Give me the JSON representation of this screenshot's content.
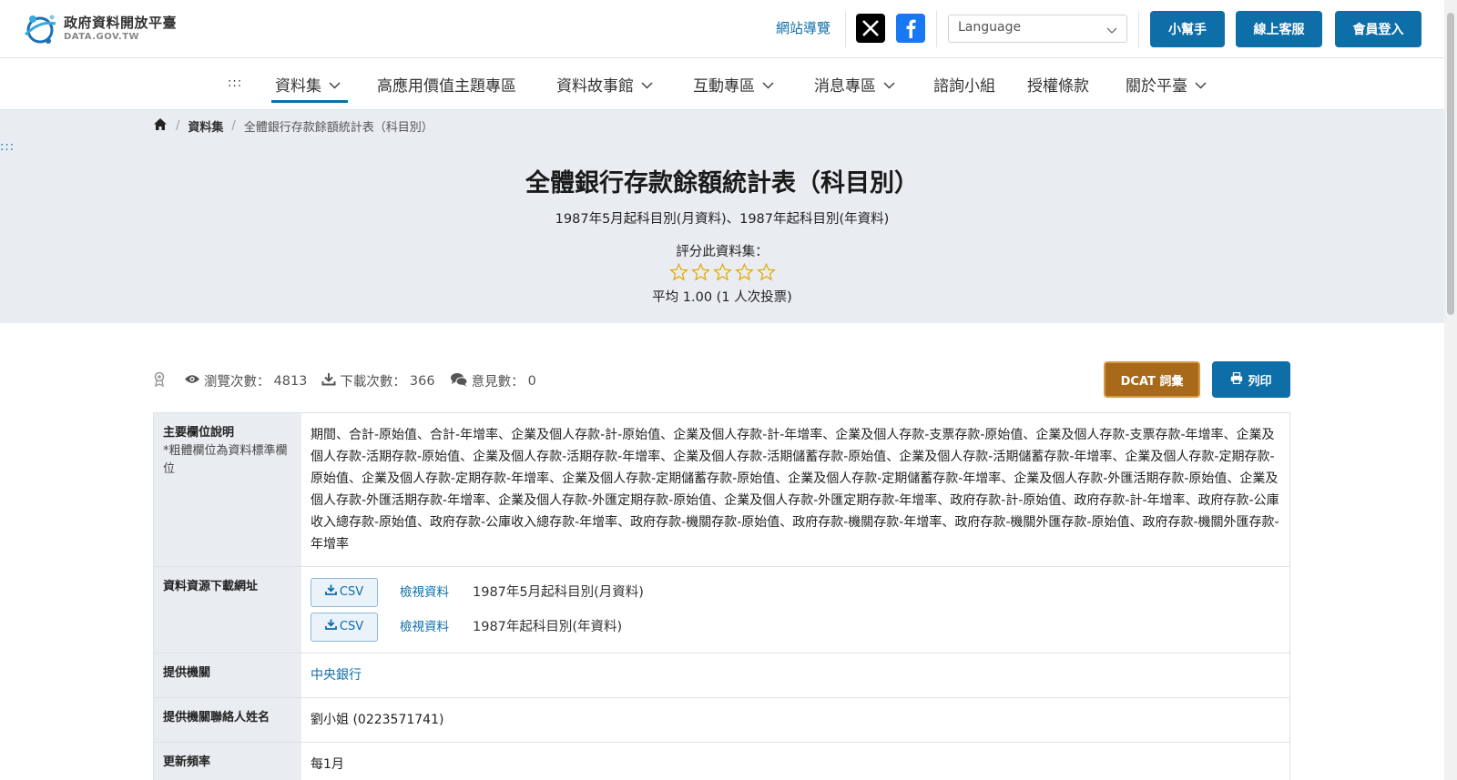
{
  "header": {
    "logo_title": "政府資料開放平臺",
    "logo_sub": "DATA.GOV.TW",
    "sitemap": "網站導覽",
    "language_placeholder": "Language",
    "buttons": {
      "helper": "小幫手",
      "service": "線上客服",
      "login": "會員登入"
    }
  },
  "nav": {
    "accesskey_top": ":::",
    "accesskey_side": ":::",
    "items": [
      {
        "label": "資料集",
        "dropdown": true,
        "active": true
      },
      {
        "label": "高應用價值主題專區",
        "dropdown": false
      },
      {
        "label": "資料故事館",
        "dropdown": true
      },
      {
        "label": "互動專區",
        "dropdown": true
      },
      {
        "label": "消息專區",
        "dropdown": true
      },
      {
        "label": "諮詢小組",
        "dropdown": false
      },
      {
        "label": "授權條款",
        "dropdown": false
      },
      {
        "label": "關於平臺",
        "dropdown": true
      }
    ]
  },
  "breadcrumb": {
    "level1": "資料集",
    "current": "全體銀行存款餘額統計表（科目別）"
  },
  "dataset": {
    "title": "全體銀行存款餘額統計表（科目別）",
    "subtitle": "1987年5月起科目別(月資料)、1987年起科目別(年資料)",
    "rate_label": "評分此資料集：",
    "rating_score": 0,
    "rating_max": 5,
    "average": "平均 1.00 (1 人次投票)"
  },
  "stats": {
    "views_label": "瀏覽次數：",
    "views": "4813",
    "downloads_label": "下載次數：",
    "downloads": "366",
    "comments_label": "意見數：",
    "comments": "0",
    "dcat_button": "DCAT 詞彙",
    "print_button": "列印"
  },
  "details": {
    "fields_label": "主要欄位說明",
    "fields_note": "*粗體欄位為資料標準欄位",
    "fields_value": "期間、合計-原始值、合計-年增率、企業及個人存款-計-原始值、企業及個人存款-計-年增率、企業及個人存款-支票存款-原始值、企業及個人存款-支票存款-年增率、企業及個人存款-活期存款-原始值、企業及個人存款-活期存款-年增率、企業及個人存款-活期儲蓄存款-原始值、企業及個人存款-活期儲蓄存款-年增率、企業及個人存款-定期存款-原始值、企業及個人存款-定期存款-年增率、企業及個人存款-定期儲蓄存款-原始值、企業及個人存款-定期儲蓄存款-年增率、企業及個人存款-外匯活期存款-原始值、企業及個人存款-外匯活期存款-年增率、企業及個人存款-外匯定期存款-原始值、企業及個人存款-外匯定期存款-年增率、政府存款-計-原始值、政府存款-計-年增率、政府存款-公庫收入總存款-原始值、政府存款-公庫收入總存款-年增率、政府存款-機關存款-原始值、政府存款-機關存款-年增率、政府存款-機關外匯存款-原始值、政府存款-機關外匯存款-年增率",
    "resources_label": "資料資源下載網址",
    "resources": [
      {
        "format": "CSV",
        "view": "檢視資料",
        "name": "1987年5月起科目別(月資料)"
      },
      {
        "format": "CSV",
        "view": "檢視資料",
        "name": "1987年起科目別(年資料)"
      }
    ],
    "agency_label": "提供機關",
    "agency": "中央銀行",
    "contact_label": "提供機關聯絡人姓名",
    "contact": "劉小姐 (0223571741)",
    "frequency_label": "更新頻率",
    "frequency": "每1月"
  }
}
